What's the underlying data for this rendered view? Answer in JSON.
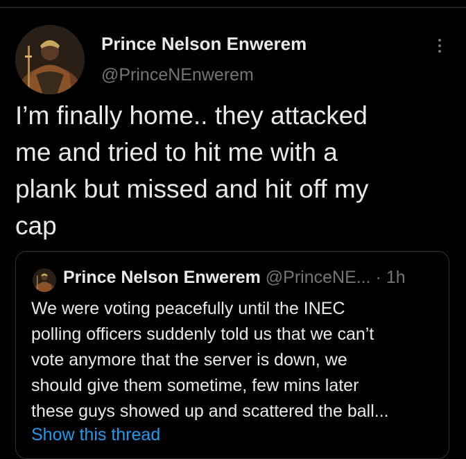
{
  "tweet": {
    "author_name": "Prince Nelson Enwerem",
    "author_handle": "@PrinceNEnwerem",
    "text_lines": [
      "I’m finally home.. they attacked",
      "me and tried to hit me with a",
      "plank but missed and hit off my",
      "cap"
    ],
    "more_icon": "more-vertical-icon"
  },
  "quoted_tweet": {
    "author_name": "Prince Nelson Enwerem",
    "author_handle": "@PrinceNE...",
    "separator": "·",
    "time": "1h",
    "text_lines": [
      "We were voting peacefully until the INEC",
      "polling officers suddenly told us that we can’t",
      "vote anymore that the server is down, we",
      "should give them sometime, few mins later",
      "these guys showed up and scattered the ball..."
    ],
    "show_thread_label": "Show this thread"
  },
  "colors": {
    "background": "#000000",
    "primary_text": "#e7e9ea",
    "secondary_text": "#71767b",
    "border": "#2f3336",
    "link": "#1d9bf0"
  }
}
